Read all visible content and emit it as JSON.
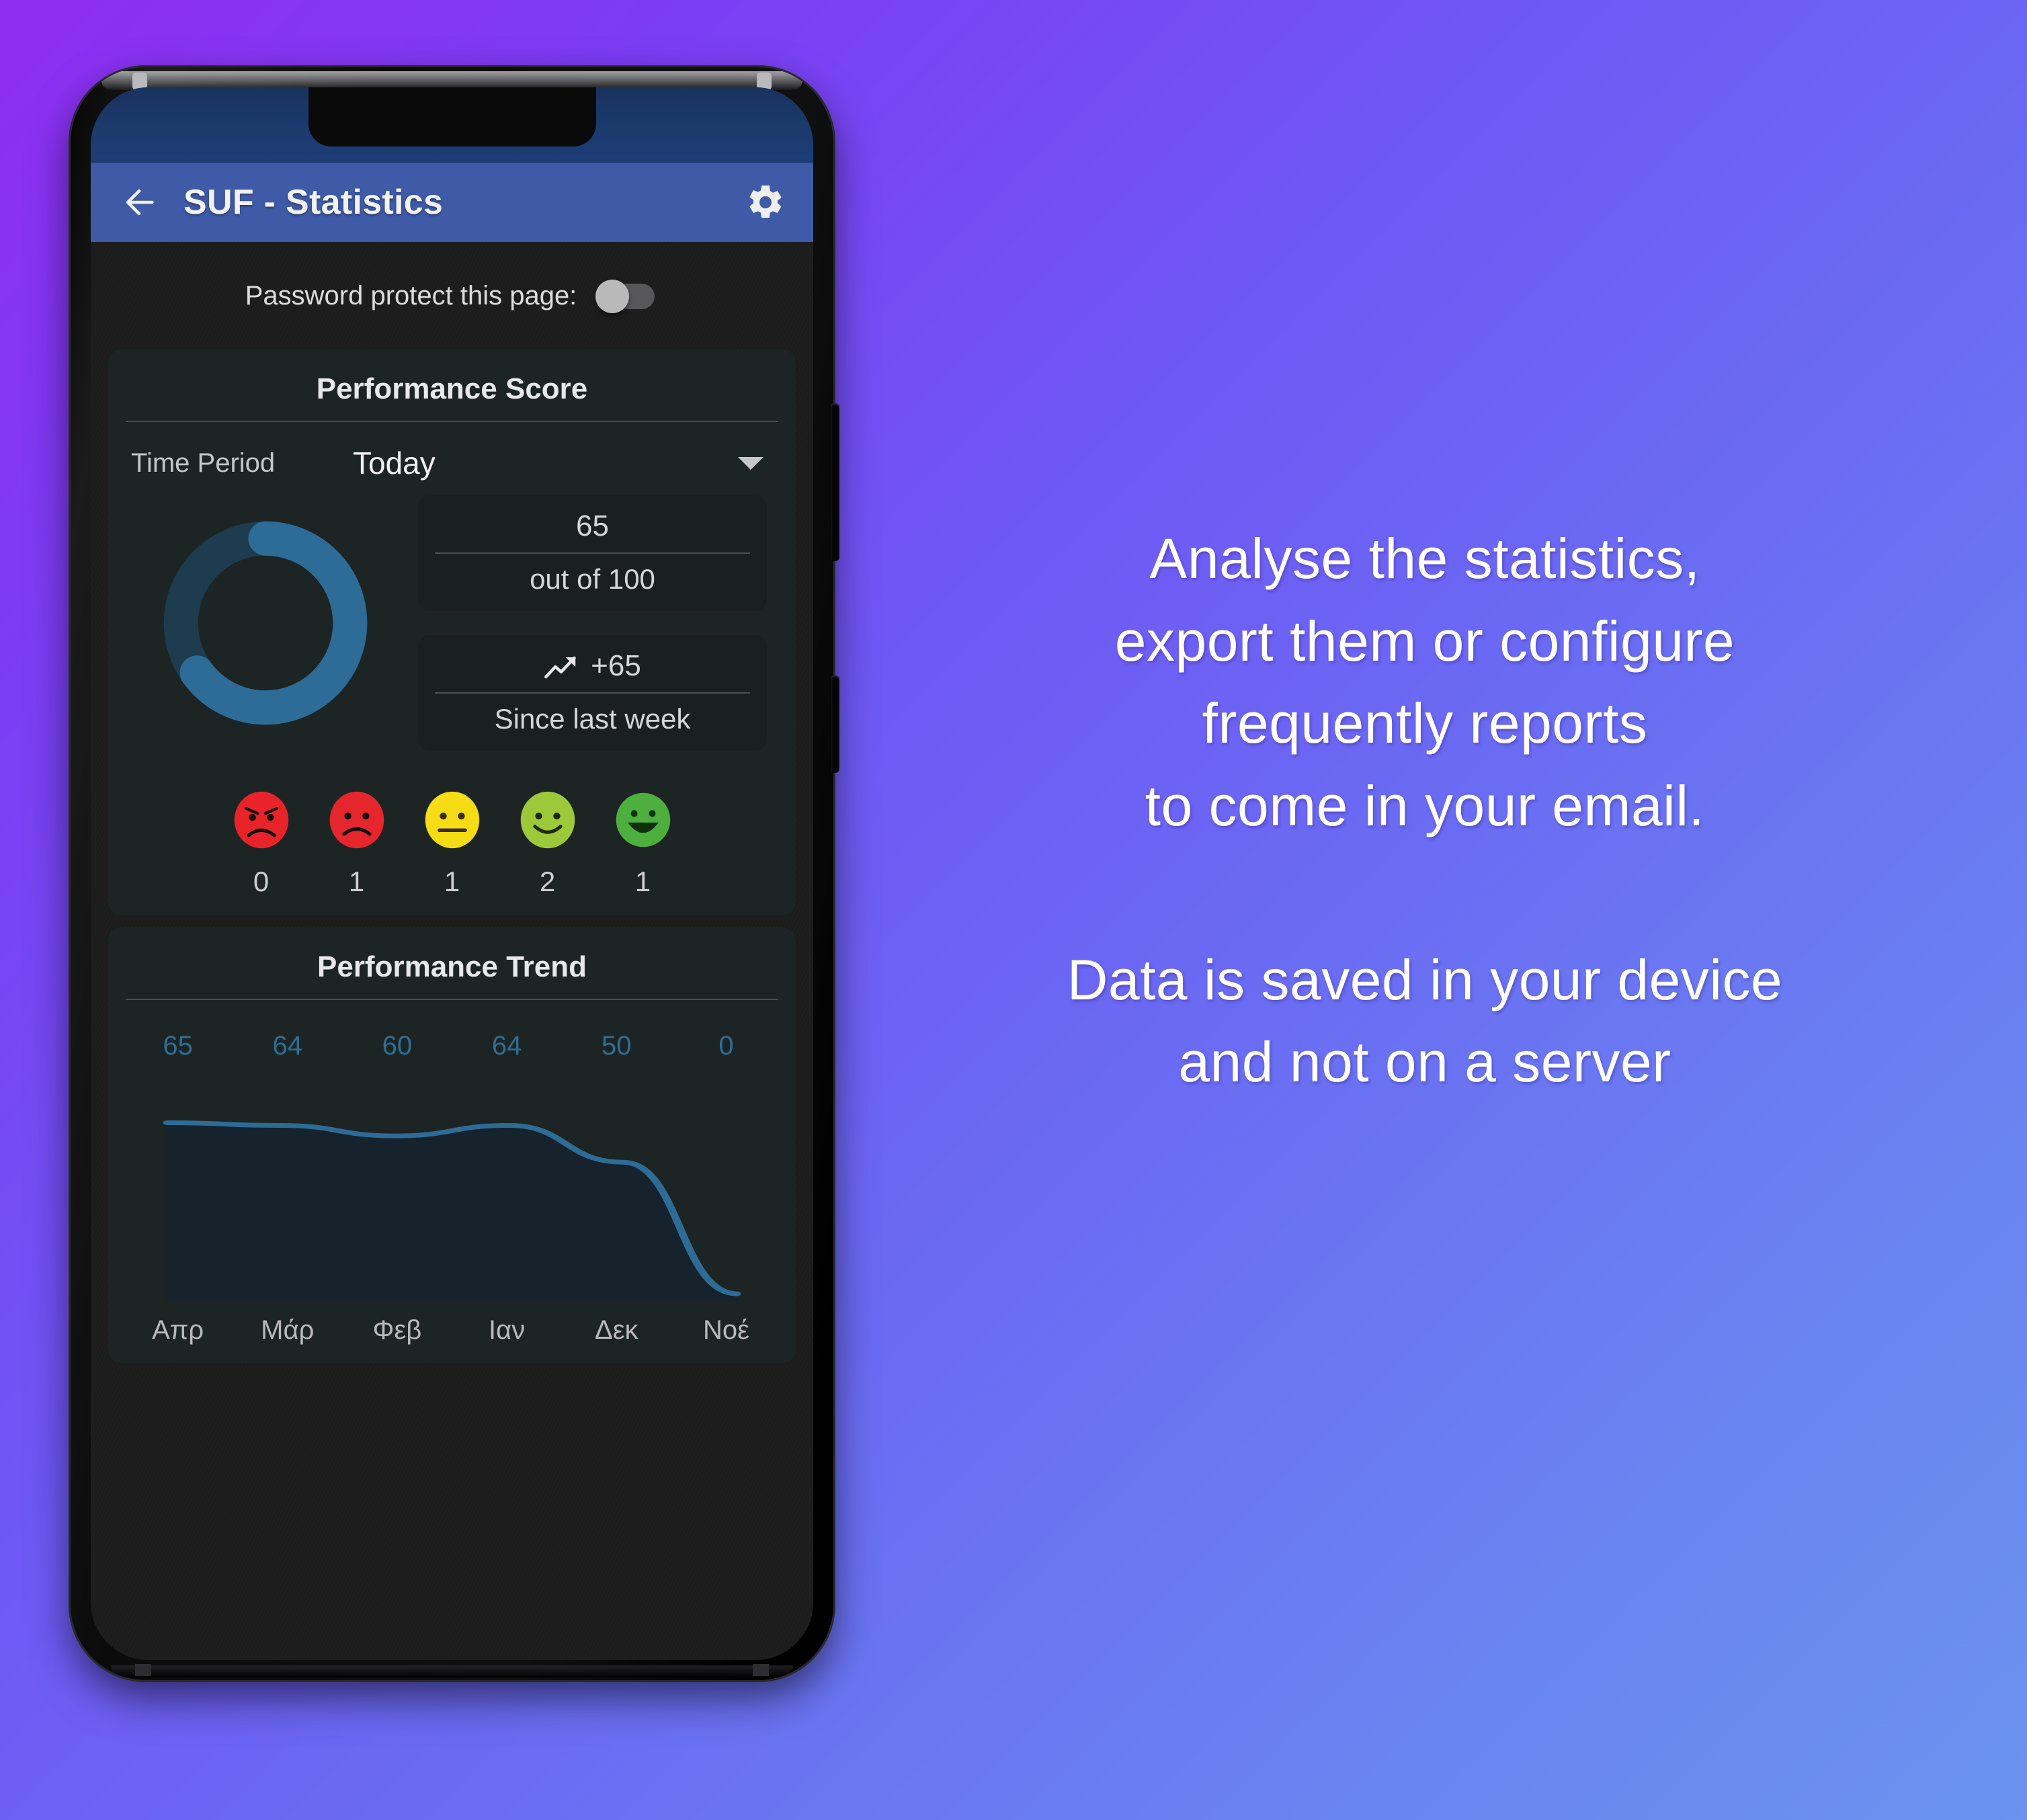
{
  "background": {
    "gradient_from": "#8f2df2",
    "gradient_to": "#6b93ef"
  },
  "phone": {
    "icons": {
      "earpiece": "speaker-grille-icon",
      "front_camera": "front-camera-icon",
      "volume_button": "volume-button",
      "power_button": "power-button"
    }
  },
  "appbar": {
    "back_icon": "arrow-left-icon",
    "title": "SUF - Statistics",
    "settings_icon": "gear-icon",
    "background": "#3f5aa6",
    "statusbar_background": "#1d3f78"
  },
  "password_row": {
    "label": "Password protect this page:",
    "toggle_state": "off"
  },
  "performance_score": {
    "title": "Performance Score",
    "time_period_label": "Time Period",
    "time_period_value": "Today",
    "dropdown_icon": "chevron-down-icon",
    "donut": {
      "value": 65,
      "max": 100,
      "arc_color": "#2d6c97",
      "track_color": "#1d3c4e"
    },
    "stat_score": {
      "value": "65",
      "caption": "out of 100"
    },
    "stat_trend": {
      "icon": "trending-up-icon",
      "value": "+65",
      "caption": "Since last week"
    },
    "ratings": [
      {
        "face": "angry-face-icon",
        "color": "#e8232a",
        "count": "0"
      },
      {
        "face": "sad-face-icon",
        "color": "#e5262c",
        "count": "1"
      },
      {
        "face": "neutral-face-icon",
        "color": "#f5dc14",
        "count": "1"
      },
      {
        "face": "smile-face-icon",
        "color": "#9cc83a",
        "count": "2"
      },
      {
        "face": "happy-face-icon",
        "color": "#45a councils",
        "count": "1"
      }
    ]
  },
  "performance_trend": {
    "title": "Performance Trend"
  },
  "chart_data": {
    "type": "line",
    "title": "Performance Trend",
    "categories": [
      "Απρ",
      "Μάρ",
      "Φεβ",
      "Ιαν",
      "Δεκ",
      "Νοέ"
    ],
    "values": [
      65,
      64,
      60,
      64,
      50,
      0
    ],
    "value_labels": [
      "65",
      "64",
      "60",
      "64",
      "50",
      "0"
    ],
    "series": [
      {
        "name": "Performance",
        "values": [
          65,
          64,
          60,
          64,
          50,
          0
        ]
      }
    ],
    "xlabel": "",
    "ylabel": "",
    "ylim": [
      0,
      70
    ],
    "grid": false,
    "legend": "none",
    "line_color": "#2d6c97",
    "fill_color": "#16222c",
    "label_color": "#2f6e96"
  },
  "copy": {
    "paragraph_1_line_1": "Analyse the statistics,",
    "paragraph_1_line_2": "export them or configure",
    "paragraph_1_line_3": "frequently reports",
    "paragraph_1_line_4": "to come in your email.",
    "paragraph_2_line_1": "Data is saved in your device",
    "paragraph_2_line_2": "and not on a server"
  }
}
